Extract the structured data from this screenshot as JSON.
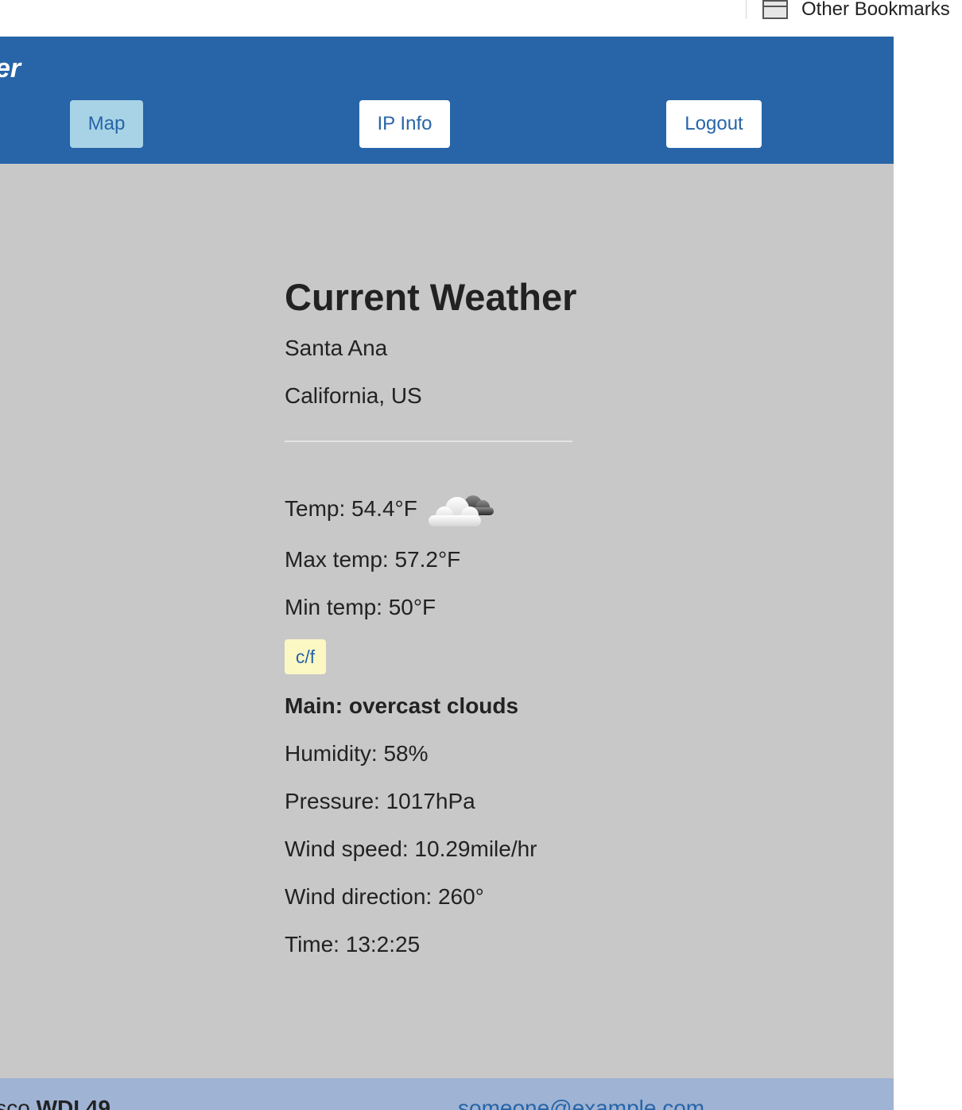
{
  "browser": {
    "bookmarks_label": "Other Bookmarks"
  },
  "header": {
    "brand_fragment": "er",
    "nav": {
      "map": "Map",
      "ip_info": "IP Info",
      "logout": "Logout"
    },
    "colors": {
      "header_bg": "#2765a8",
      "map_active_bg": "#a8d3e6",
      "button_bg": "#ffffff"
    }
  },
  "weather": {
    "title": "Current Weather",
    "city": "Santa Ana",
    "region": "California, US",
    "temp": "Temp: 54.4°F",
    "icon": "overcast-cloud-icon",
    "max_temp": "Max temp: 57.2°F",
    "min_temp": "Min temp: 50°F",
    "unit_toggle": "c/f",
    "main": "Main: overcast clouds",
    "humidity": "Humidity: 58%",
    "pressure": "Pressure: 1017hPa",
    "wind_speed": "Wind speed: 10.29mile/hr",
    "wind_direction": "Wind direction: 260°",
    "time": "Time: 13:2:25",
    "colors": {
      "page_bg": "#c8c8c8",
      "toggle_bg": "#fcf8c4"
    }
  },
  "footer": {
    "left_prefix": "cisco ",
    "left_bold": "WDI 49",
    "email": "someone@example.com",
    "colors": {
      "footer_bg": "#9fb3d4"
    }
  }
}
